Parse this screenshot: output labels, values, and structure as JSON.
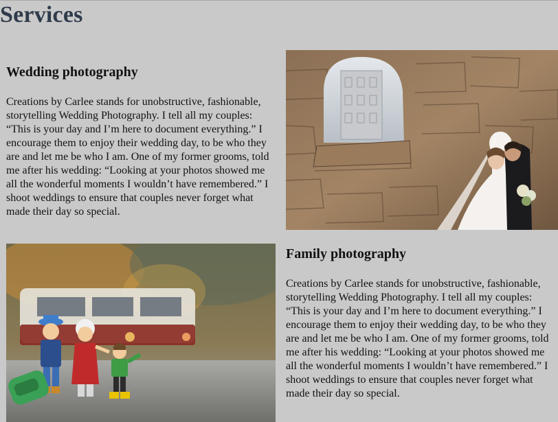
{
  "page": {
    "title": "Services"
  },
  "sections": [
    {
      "heading": "Wedding photography",
      "body": "Creations by Carlee stands for unobstructive, fashionable, storytelling Wedding Photography. I tell all my couples: “This is your day and I’m here to document everything.” I encourage them to enjoy their wedding day, to be who they are and let me be who I am. One of my former grooms, told me after his wedding: “Looking at your photos showed me all the wonderful moments I wouldn’t have remembered.” I shoot weddings to ensure that couples never forget what made their day so special."
    },
    {
      "heading": "Family photography",
      "body": "Creations by Carlee stands for unobstructive, fashionable, storytelling Wedding Photography. I tell all my couples: “This is your day and I’m here to document everything.” I encourage them to enjoy their wedding day, to be who they are and let me be who I am. One of my former grooms, told me after his wedding: “Looking at your photos showed me all the wonderful moments I wouldn’t have remembered.” I shoot weddings to ensure that couples never forget what made their day so special."
    }
  ],
  "colors": {
    "background": "#c9c9c9",
    "title": "#2f3b4b",
    "text": "#111111"
  }
}
